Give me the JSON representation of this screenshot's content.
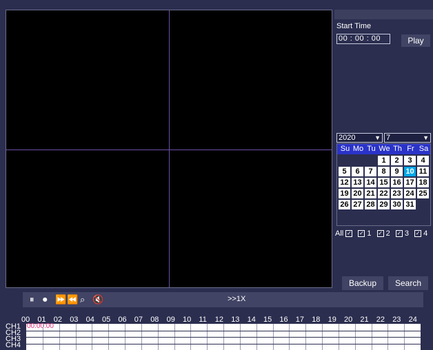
{
  "right_panel": {
    "start_time_label": "Start Time",
    "time_value": "00 : 00 : 00",
    "play_label": "Play",
    "year": "2020",
    "month": "7",
    "backup_label": "Backup",
    "search_label": "Search"
  },
  "calendar": {
    "weekdays": [
      "Su",
      "Mo",
      "Tu",
      "We",
      "Th",
      "Fr",
      "Sa"
    ],
    "days": [
      "1",
      "2",
      "3",
      "4",
      "5",
      "6",
      "7",
      "8",
      "9",
      "10",
      "11",
      "12",
      "13",
      "14",
      "15",
      "16",
      "17",
      "18",
      "19",
      "20",
      "21",
      "22",
      "23",
      "24",
      "25",
      "26",
      "27",
      "28",
      "29",
      "30",
      "31"
    ],
    "selected_day": "10"
  },
  "channels": {
    "all_label": "All",
    "items": [
      "1",
      "2",
      "3",
      "4"
    ]
  },
  "controls": {
    "speed_label": ">>1X"
  },
  "timeline": {
    "hours": [
      "00",
      "01",
      "02",
      "03",
      "04",
      "05",
      "06",
      "07",
      "08",
      "09",
      "10",
      "11",
      "12",
      "13",
      "14",
      "15",
      "16",
      "17",
      "18",
      "19",
      "20",
      "21",
      "22",
      "23",
      "24"
    ],
    "channels": [
      "CH1",
      "CH2",
      "CH3",
      "CH4"
    ],
    "current_time": "00:00:00"
  },
  "colors": {
    "background": "#2b2e4f",
    "calendar_header": "#2a33c9",
    "selected_day": "#00a7e8",
    "split_line": "#6d4fa8",
    "time_marker": "#e0307a"
  }
}
